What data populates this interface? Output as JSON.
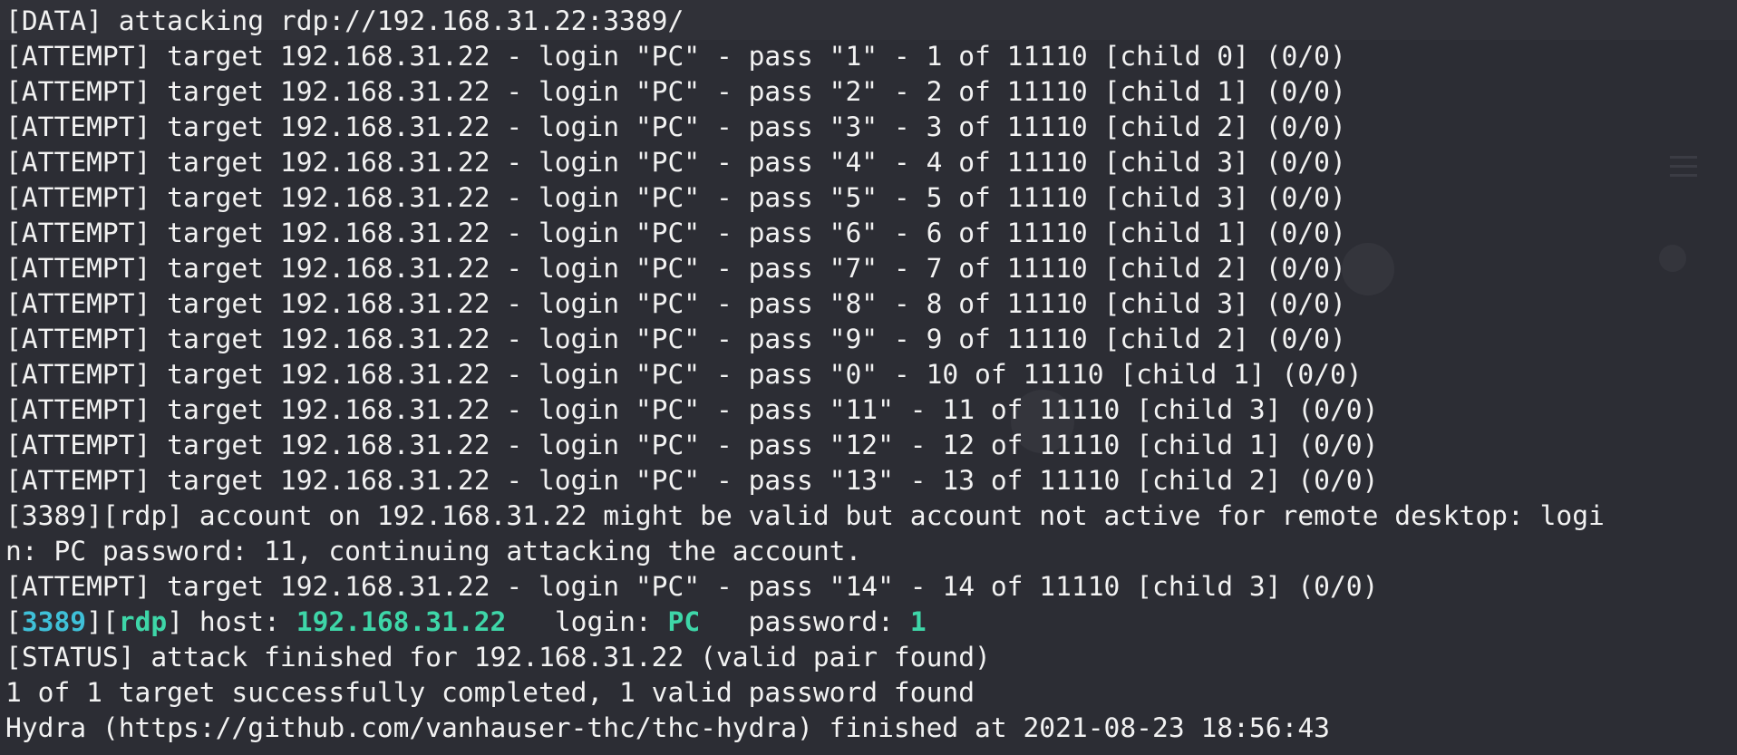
{
  "terminal": {
    "lines": [
      "[DATA] attacking rdp://192.168.31.22:3389/",
      "[ATTEMPT] target 192.168.31.22 - login \"PC\" - pass \"1\" - 1 of 11110 [child 0] (0/0)",
      "[ATTEMPT] target 192.168.31.22 - login \"PC\" - pass \"2\" - 2 of 11110 [child 1] (0/0)",
      "[ATTEMPT] target 192.168.31.22 - login \"PC\" - pass \"3\" - 3 of 11110 [child 2] (0/0)",
      "[ATTEMPT] target 192.168.31.22 - login \"PC\" - pass \"4\" - 4 of 11110 [child 3] (0/0)",
      "[ATTEMPT] target 192.168.31.22 - login \"PC\" - pass \"5\" - 5 of 11110 [child 3] (0/0)",
      "[ATTEMPT] target 192.168.31.22 - login \"PC\" - pass \"6\" - 6 of 11110 [child 1] (0/0)",
      "[ATTEMPT] target 192.168.31.22 - login \"PC\" - pass \"7\" - 7 of 11110 [child 2] (0/0)",
      "[ATTEMPT] target 192.168.31.22 - login \"PC\" - pass \"8\" - 8 of 11110 [child 3] (0/0)",
      "[ATTEMPT] target 192.168.31.22 - login \"PC\" - pass \"9\" - 9 of 11110 [child 2] (0/0)",
      "[ATTEMPT] target 192.168.31.22 - login \"PC\" - pass \"0\" - 10 of 11110 [child 1] (0/0)",
      "[ATTEMPT] target 192.168.31.22 - login \"PC\" - pass \"11\" - 11 of 11110 [child 3] (0/0)",
      "[ATTEMPT] target 192.168.31.22 - login \"PC\" - pass \"12\" - 12 of 11110 [child 1] (0/0)",
      "[ATTEMPT] target 192.168.31.22 - login \"PC\" - pass \"13\" - 13 of 11110 [child 2] (0/0)",
      "[3389][rdp] account on 192.168.31.22 might be valid but account not active for remote desktop: logi",
      "n: PC password: 11, continuing attacking the account.",
      "[ATTEMPT] target 192.168.31.22 - login \"PC\" - pass \"14\" - 14 of 11110 [child 3] (0/0)"
    ],
    "found": {
      "open_bracket": "[",
      "port": "3389",
      "mid_bracket": "][",
      "proto": "rdp",
      "host_label": "] host: ",
      "host": "192.168.31.22",
      "login_label": "   login: ",
      "login": "PC",
      "password_label": "   password: ",
      "password": "1"
    },
    "tail_lines": [
      "[STATUS] attack finished for 192.168.31.22 (valid pair found)",
      "1 of 1 target successfully completed, 1 valid password found",
      "Hydra (https://github.com/vanhauser-thc/thc-hydra) finished at 2021-08-23 18:56:43"
    ]
  },
  "colors": {
    "background": "#2c2d34",
    "text": "#f2f2f2",
    "port_highlight": "#3fc0d8",
    "value_highlight": "#3ed6a8"
  }
}
